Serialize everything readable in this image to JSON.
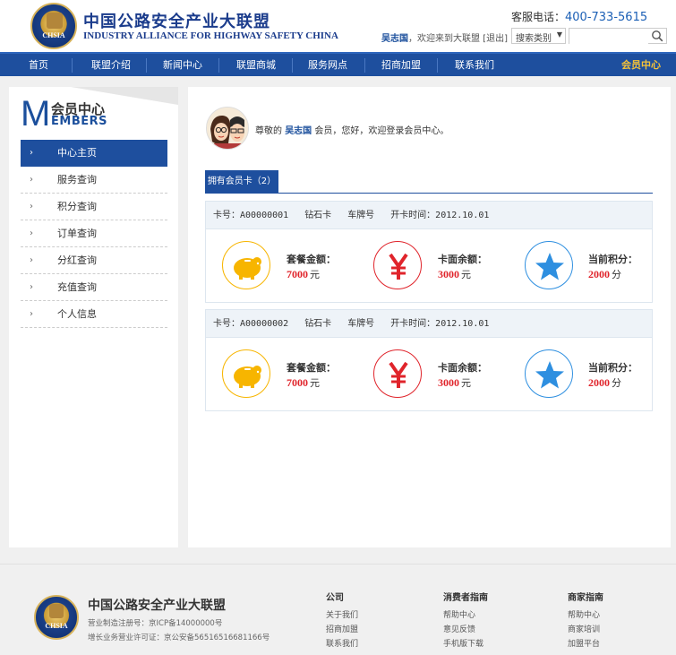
{
  "header": {
    "logo_text": "CHSIA",
    "brand_cn": "中国公路安全产业大联盟",
    "brand_en": "INDUSTRY ALLIANCE FOR HIGHWAY SAFETY CHINA",
    "hotline_label": "客服电话：",
    "hotline_number": "400-733-5615",
    "user_name": "吴志国",
    "welcome_text": "，欢迎来到大联盟 [退出]",
    "search_category": "搜索类别",
    "search_placeholder": ""
  },
  "nav": {
    "items": [
      "首页",
      "联盟介绍",
      "新闻中心",
      "联盟商城",
      "服务网点",
      "招商加盟",
      "联系我们"
    ],
    "member": "会员中心"
  },
  "sidebar": {
    "logo_letter": "M",
    "title_cn": "会员中心",
    "title_en": "EMBERS",
    "menu": [
      "中心主页",
      "服务查询",
      "积分查询",
      "订单查询",
      "分红查询",
      "充值查询",
      "个人信息"
    ],
    "arrow": "›"
  },
  "main": {
    "greet_prefix": "尊敬的",
    "greet_name": "吴志国",
    "greet_suffix": "会员，您好，欢迎登录会员中心。",
    "tab_label": "拥有会员卡（2）",
    "cards": [
      {
        "card_no": "卡号：A00000001",
        "level": "钻石卡",
        "plate": "车牌号",
        "open_date": "开卡时间：2012.10.01",
        "package_label": "套餐金额：",
        "package_value": "7000",
        "package_unit": "元",
        "balance_label": "卡面余额：",
        "balance_value": "3000",
        "balance_unit": "元",
        "points_label": "当前积分：",
        "points_value": "2000",
        "points_unit": "分"
      },
      {
        "card_no": "卡号：A00000002",
        "level": "钻石卡",
        "plate": "车牌号",
        "open_date": "开卡时间：2012.10.01",
        "package_label": "套餐金额：",
        "package_value": "7000",
        "package_unit": "元",
        "balance_label": "卡面余额：",
        "balance_value": "3000",
        "balance_unit": "元",
        "points_label": "当前积分：",
        "points_value": "2000",
        "points_unit": "分"
      }
    ],
    "icon_colors": {
      "piggy": "#f7b500",
      "yen": "#e0242b",
      "star": "#2e8fe0"
    }
  },
  "footer": {
    "logo_text": "CHSIA",
    "name": "中国公路安全产业大联盟",
    "license_1": "营业制造注册号：京ICP备14000000号",
    "license_2": "增长业务营业许可证：京公安备56516516681166号",
    "columns": [
      {
        "title": "公司",
        "links": [
          "关于我们",
          "招商加盟",
          "联系我们"
        ]
      },
      {
        "title": "消费者指南",
        "links": [
          "帮助中心",
          "意见反馈",
          "手机版下载"
        ]
      },
      {
        "title": "商家指南",
        "links": [
          "帮助中心",
          "商家培训",
          "加盟平台"
        ]
      }
    ]
  }
}
